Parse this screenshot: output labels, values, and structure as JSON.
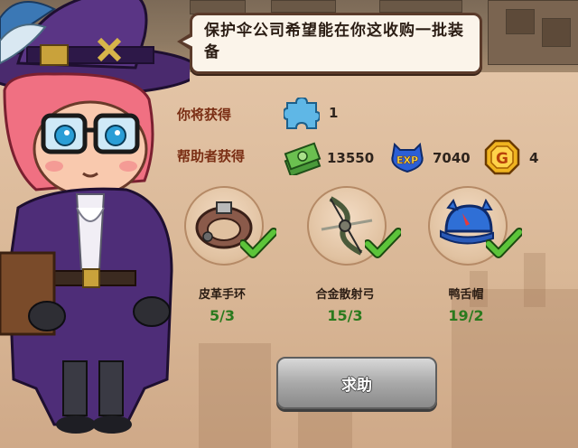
{
  "dialog": {
    "message": "保护伞公司希望能在你这收购一批装备"
  },
  "rewards": {
    "you_get_label": "你将获得",
    "puzzle_count": "1",
    "helper_get_label": "帮助者获得",
    "cash_amount": "13550",
    "exp_amount": "7040",
    "coin_amount": "4"
  },
  "items": [
    {
      "name": "皮革手环",
      "count": "5/3",
      "icon": "leather-bracelet-icon"
    },
    {
      "name": "合金散射弓",
      "count": "15/3",
      "icon": "alloy-compound-bow-icon"
    },
    {
      "name": "鸭舌帽",
      "count": "19/2",
      "icon": "cap-icon"
    }
  ],
  "buttons": {
    "help_label": "求助"
  },
  "colors": {
    "label_red": "#7a2e14",
    "count_green": "#2b7a1e",
    "check_green": "#5cc43a",
    "button_grey": "#a9a9a9"
  }
}
